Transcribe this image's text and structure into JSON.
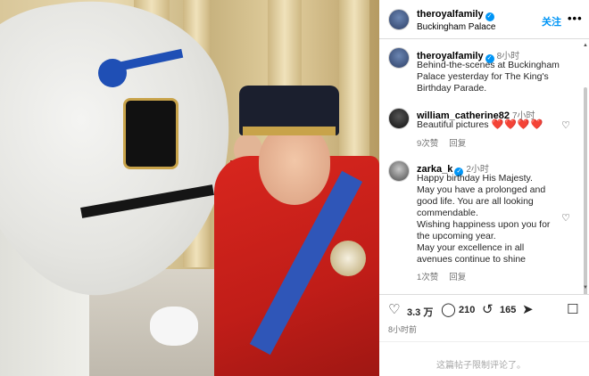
{
  "header": {
    "username": "theroyalfamily",
    "location": "Buckingham Palace",
    "follow_label": "关注",
    "more_label": "•••"
  },
  "caption": {
    "username": "theroyalfamily",
    "time": "8小时",
    "text_lines": [
      "Behind-the-scenes at Buckingham",
      "Palace yesterday for The King's",
      "Birthday Parade."
    ]
  },
  "comments": [
    {
      "username": "william_catherine82",
      "time": "7小时",
      "text": "Beautiful pictures",
      "hearts": "❤️❤️❤️❤️",
      "likes": "9次赞",
      "reply_label": "回复"
    },
    {
      "username": "zarka_k",
      "time": "2小时",
      "text_lines": [
        "Happy birthday His Majesty.",
        "May you have a prolonged and",
        "good life. You are all looking",
        "commendable.",
        "Wishing happiness upon you for",
        "the upcoming year.",
        "May your excellence in all",
        "avenues continue to shine"
      ],
      "likes": "1次赞",
      "reply_label": "回复"
    }
  ],
  "actions": {
    "likes_count": "3.3 万",
    "comments_count": "210",
    "shares_count": "165",
    "posted_time": "8小时前"
  },
  "footer": {
    "comments_limited": "这篇帖子限制评论了。"
  },
  "colors": {
    "link_blue": "#0095f6",
    "verified_blue": "#0095f6",
    "heart_red": "#ed4956",
    "muted_gray": "#737373"
  }
}
